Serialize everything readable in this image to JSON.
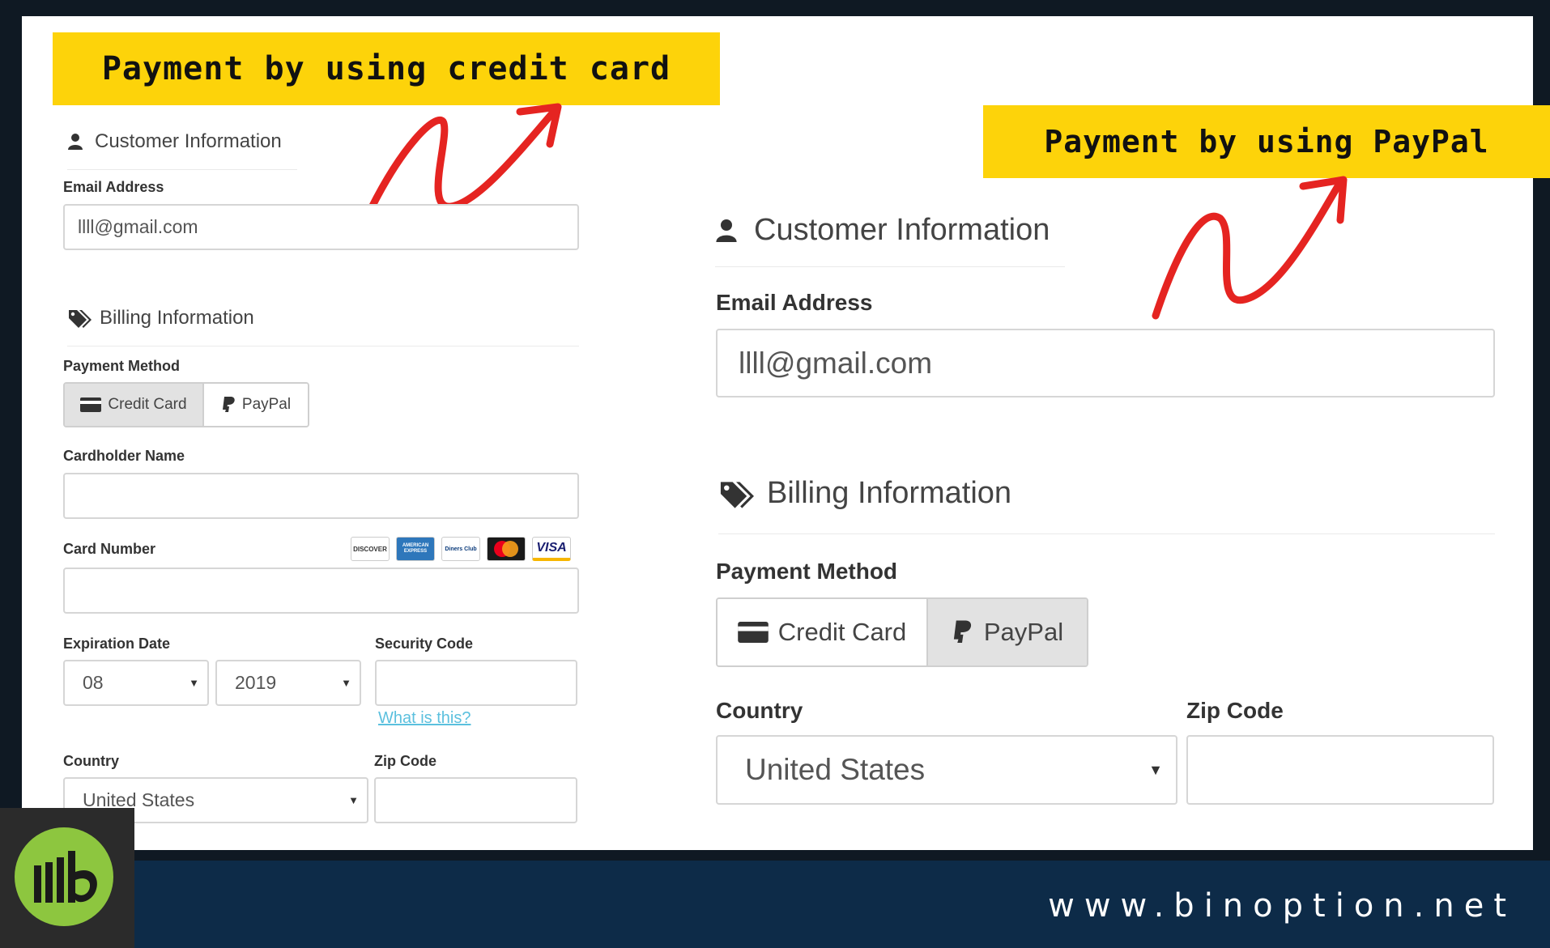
{
  "banners": {
    "left": "Payment by using credit card",
    "right": "Payment by using PayPal"
  },
  "left_form": {
    "customer_heading": "Customer Information",
    "email_label": "Email Address",
    "email_value": "llll@gmail.com",
    "billing_heading": "Billing Information",
    "payment_method_label": "Payment Method",
    "credit_card_label": "Credit Card",
    "paypal_label": "PayPal",
    "cardholder_label": "Cardholder Name",
    "card_number_label": "Card Number",
    "card_brands": [
      "DISCOVER",
      "AMERICAN EXPRESS",
      "Diners Club",
      "mastercard",
      "VISA"
    ],
    "expiration_label": "Expiration Date",
    "exp_month": "08",
    "exp_year": "2019",
    "security_label": "Security Code",
    "what_is_this": "What is this?",
    "country_label": "Country",
    "country_value": "United States",
    "zip_label": "Zip Code"
  },
  "right_form": {
    "customer_heading": "Customer Information",
    "email_label": "Email Address",
    "email_value": "llll@gmail.com",
    "billing_heading": "Billing Information",
    "payment_method_label": "Payment Method",
    "credit_card_label": "Credit Card",
    "paypal_label": "PayPal",
    "country_label": "Country",
    "country_value": "United States",
    "zip_label": "Zip Code"
  },
  "footer": {
    "url": "www.binoption.net",
    "logo_text": "lllb"
  },
  "colors": {
    "banner": "#fdd30a",
    "arrow": "#e52421",
    "footer": "#0d2b48",
    "logo": "#8dc63f",
    "link": "#5bc0de"
  }
}
